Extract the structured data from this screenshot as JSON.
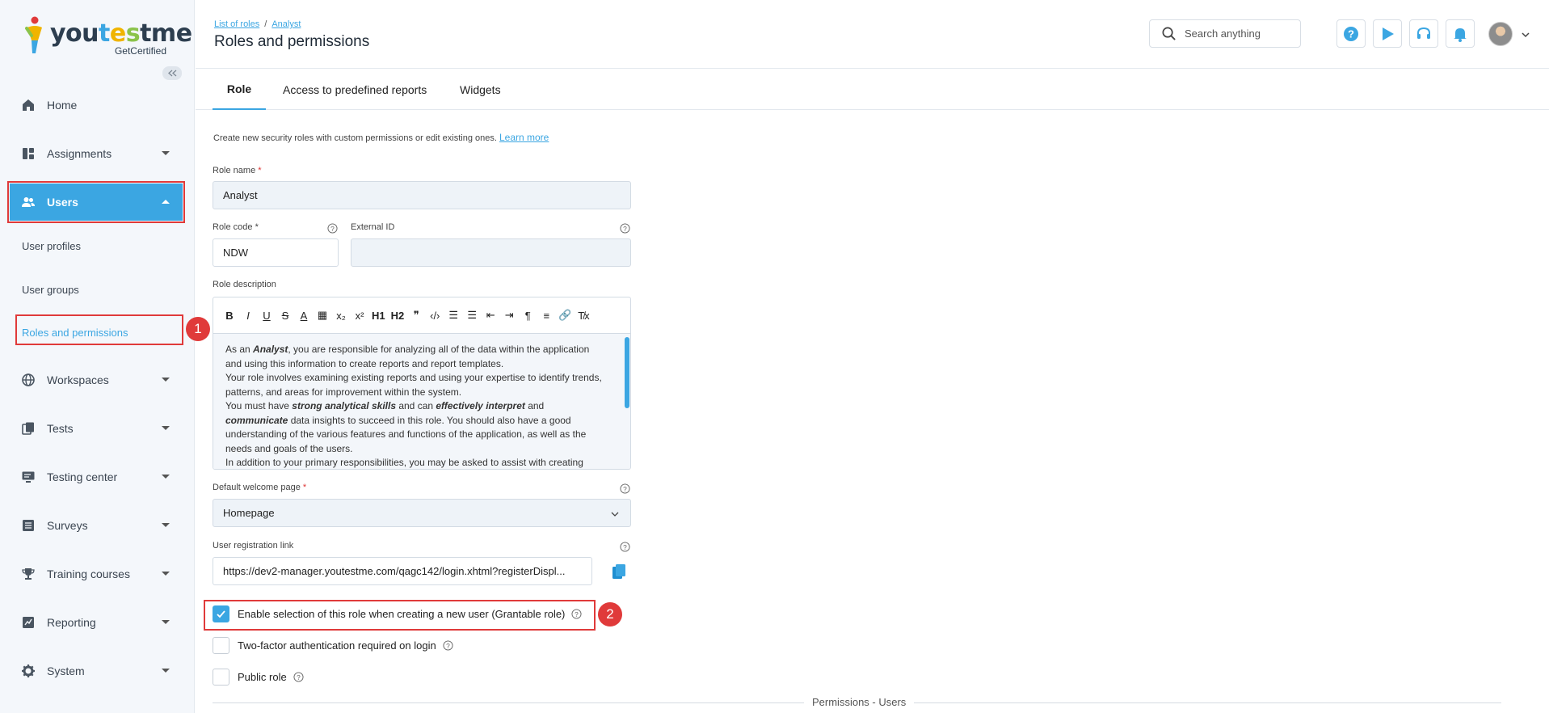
{
  "brand": {
    "word_1": "you",
    "word_2": "t",
    "word_3": "e",
    "word_4": "s",
    "word_5": "tme",
    "sub": "GetCertified"
  },
  "sidebar": {
    "items": [
      {
        "label": "Home",
        "icon": "home-icon"
      },
      {
        "label": "Assignments",
        "icon": "dashboard-icon"
      },
      {
        "label": "Users",
        "icon": "users-icon"
      },
      {
        "label": "Workspaces",
        "icon": "globe-icon"
      },
      {
        "label": "Tests",
        "icon": "copy-icon"
      },
      {
        "label": "Testing center",
        "icon": "monitor-icon"
      },
      {
        "label": "Surveys",
        "icon": "list-icon"
      },
      {
        "label": "Training courses",
        "icon": "trophy-icon"
      },
      {
        "label": "Reporting",
        "icon": "chart-icon"
      },
      {
        "label": "System",
        "icon": "gear-icon"
      }
    ],
    "sub_items": [
      "User profiles",
      "User groups",
      "Roles and permissions"
    ]
  },
  "badges": [
    "1",
    "2"
  ],
  "breadcrumb": [
    "List of roles",
    "Analyst"
  ],
  "breadcrumb_sep": "/",
  "page_title": "Roles and permissions",
  "search": {
    "placeholder": "Search anything"
  },
  "tabs": [
    "Role",
    "Access to predefined reports",
    "Widgets"
  ],
  "form": {
    "intro": "Create new security roles with custom permissions or edit existing ones.",
    "learn_more": "Learn more",
    "role_name_label": "Role name",
    "role_name_value": "Analyst",
    "role_code_label": "Role code",
    "role_code_value": "NDW",
    "external_id_label": "External ID",
    "external_id_value": "",
    "required_mark": "*",
    "description_label": "Role description",
    "toolbar": [
      "B",
      "I",
      "U",
      "S",
      "A",
      "▦",
      "x₂",
      "x²",
      "H1",
      "H2",
      "❞",
      "‹/›",
      "☰",
      "☰",
      "⇤",
      "⇥",
      "¶",
      "≡",
      "🔗",
      "T̸x"
    ],
    "description": {
      "p1_a": "As an ",
      "p1_b": "Analyst",
      "p1_c": ", you are responsible for analyzing all of the data within the application and using this information to create reports and report templates.",
      "p2": "Your role involves examining existing reports and using your expertise to identify trends, patterns, and areas for improvement within the system.",
      "p3_a": "You must have ",
      "p3_b": "strong analytical skills",
      "p3_c": " and can ",
      "p3_d": "effectively interpret",
      "p3_e": " and ",
      "p3_f": "communicate",
      "p3_g": " data insights to succeed in this role. You should also have a good understanding of the various features and functions of the application, as well as the needs and goals of the users.",
      "p4": "In addition to your primary responsibilities, you may be asked to assist with creating"
    },
    "welcome_label": "Default welcome page",
    "welcome_value": "Homepage",
    "registration_label": "User registration link",
    "registration_value": "https://dev2-manager.youtestme.com/qagc142/login.xhtml?registerDispl...",
    "grantable_label": "Enable selection of this role when creating a new user (Grantable role)",
    "grantable_checked": true,
    "twofactor_label": "Two-factor authentication required on login",
    "twofactor_checked": false,
    "public_label": "Public role",
    "public_checked": false
  },
  "section_title": "Permissions - Users",
  "colors": {
    "accent": "#3ba6e2",
    "highlight": "#e03a3a"
  }
}
